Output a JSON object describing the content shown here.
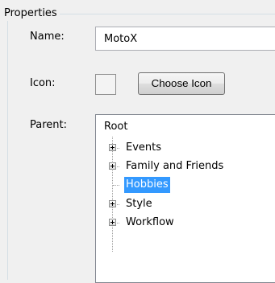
{
  "group": {
    "title": "Properties"
  },
  "fields": {
    "name_label": "Name:",
    "name_value": "MotoX",
    "icon_label": "Icon:",
    "choose_icon_label": "Choose Icon",
    "parent_label": "Parent:"
  },
  "tree": {
    "root_label": "Root",
    "items": [
      {
        "label": "Events",
        "expandable": true,
        "selected": false
      },
      {
        "label": "Family and Friends",
        "expandable": true,
        "selected": false
      },
      {
        "label": "Hobbies",
        "expandable": false,
        "selected": true
      },
      {
        "label": "Style",
        "expandable": true,
        "selected": false
      },
      {
        "label": "Workflow",
        "expandable": true,
        "selected": false
      }
    ]
  },
  "colors": {
    "selection": "#3399ff",
    "group_border": "#d5dfe5"
  }
}
